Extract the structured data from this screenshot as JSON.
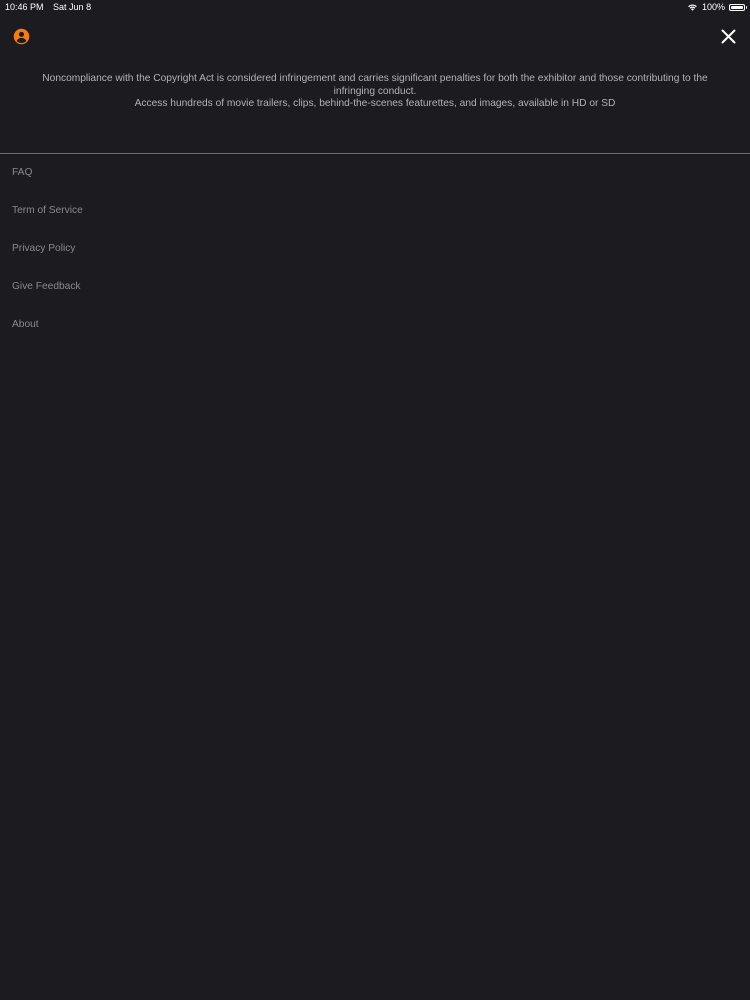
{
  "status_bar": {
    "time": "10:46 PM",
    "date": "Sat Jun 8",
    "battery_text": "100%",
    "battery_level": 1.0,
    "wifi_icon": "wifi-icon",
    "battery_icon": "battery-icon"
  },
  "header": {
    "profile_icon": "user-circle-icon",
    "close_icon": "close-icon",
    "accent_color": "#f07c1a"
  },
  "notice": {
    "line1": "Noncompliance with the Copyright Act is considered infringement and carries significant penalties for both the exhibitor and those contributing to the infringing conduct.",
    "line2": "Access hundreds of movie trailers, clips, behind-the-scenes featurettes, and images, available in HD or SD"
  },
  "menu": {
    "items": [
      {
        "label": "FAQ"
      },
      {
        "label": "Term of Service"
      },
      {
        "label": "Privacy Policy"
      },
      {
        "label": "Give Feedback"
      },
      {
        "label": "About"
      }
    ]
  },
  "colors": {
    "background": "#1c1b1f",
    "text_primary": "#b3b2b7",
    "text_menu": "#8a898e",
    "divider": "#6a696e"
  }
}
